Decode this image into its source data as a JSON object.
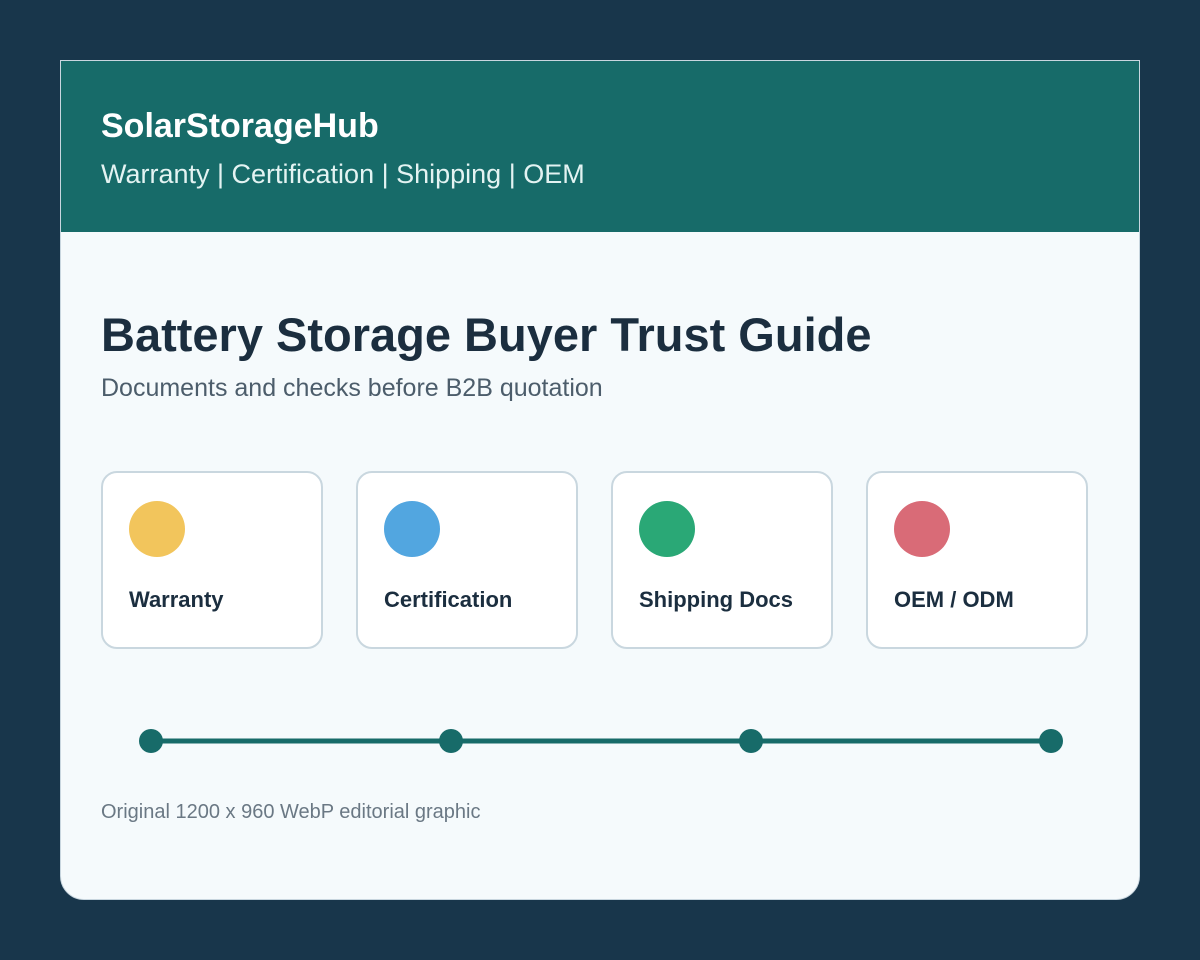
{
  "header": {
    "brand": "SolarStorageHub",
    "tagline": "Warranty | Certification | Shipping | OEM"
  },
  "main": {
    "title": "Battery Storage Buyer Trust Guide",
    "subtitle": "Documents and checks before B2B quotation",
    "cards": [
      {
        "label": "Warranty",
        "color": "#f2c55c"
      },
      {
        "label": "Certification",
        "color": "#52a6e0"
      },
      {
        "label": "Shipping Docs",
        "color": "#2aa876"
      },
      {
        "label": "OEM / ODM",
        "color": "#d96b77"
      }
    ],
    "timeline": {
      "steps": 4,
      "color": "#176b69"
    },
    "footer_note": "Original 1200 x 960 WebP editorial graphic"
  },
  "colors": {
    "background": "#18364b",
    "header": "#176b69",
    "card": "#f5fafc",
    "text_dark": "#1b2e3f"
  }
}
